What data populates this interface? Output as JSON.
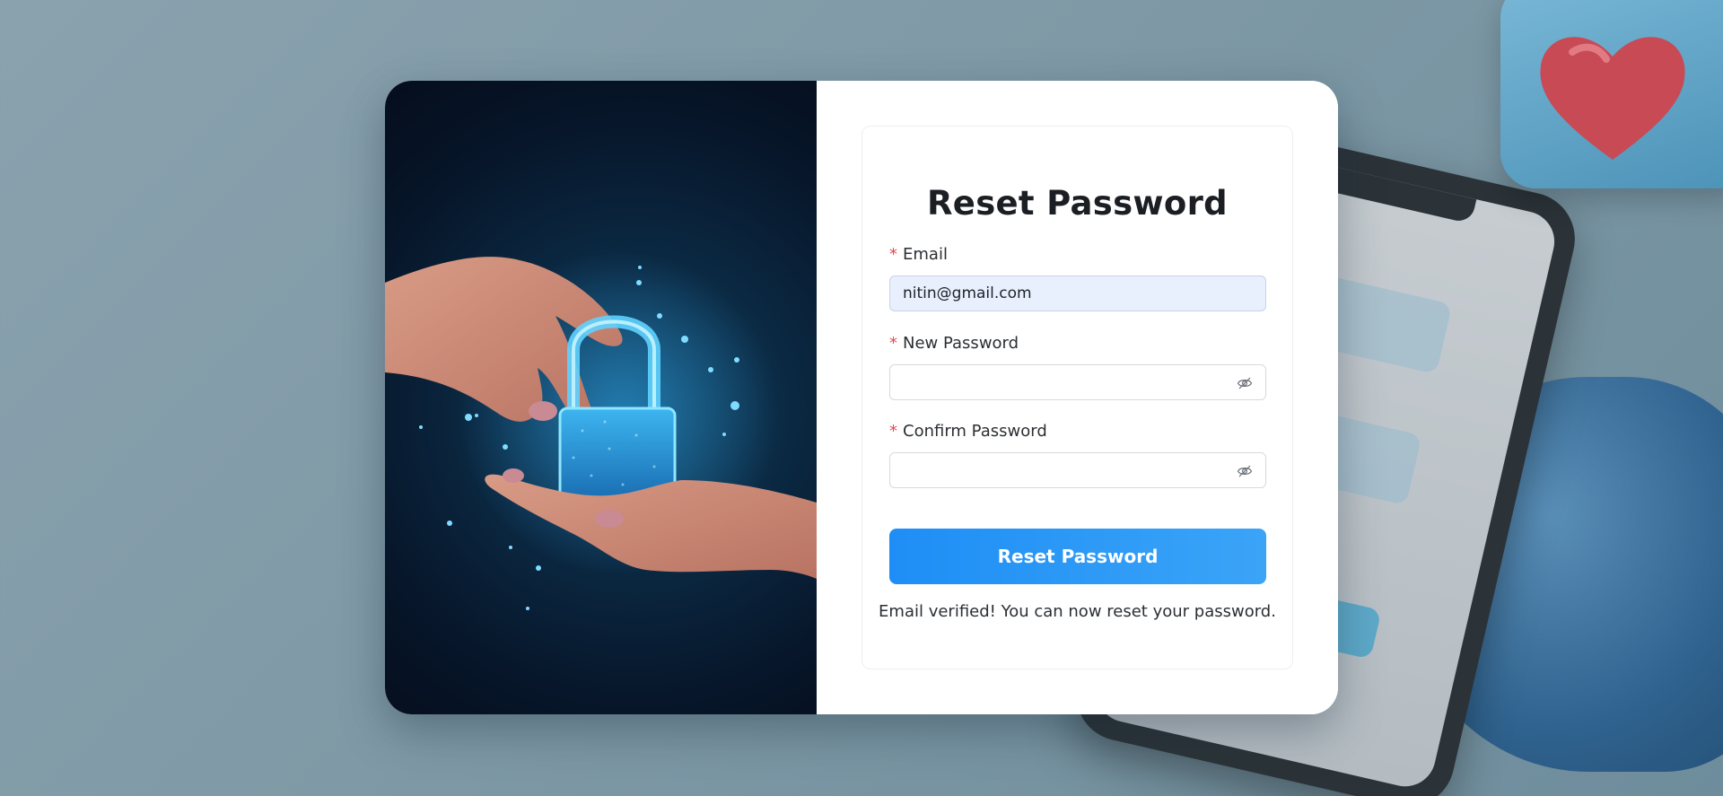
{
  "form": {
    "title": "Reset Password",
    "email_label": "Email",
    "email_value": "nitin@gmail.com",
    "new_password_label": "New Password",
    "new_password_value": "",
    "confirm_password_label": "Confirm Password",
    "confirm_password_value": "",
    "required_mark": "*",
    "submit_label": "Reset Password",
    "status_message": "Email verified! You can now reset your password."
  },
  "icons": {
    "password_toggle": "eye-off-icon",
    "illustration": "padlock-in-hands"
  },
  "colors": {
    "accent": "#1e8ef6",
    "accent_end": "#3ba4f7",
    "required": "#e5484d",
    "autofill_bg": "#e8f0fe",
    "illustration_bg": "#07162a"
  }
}
